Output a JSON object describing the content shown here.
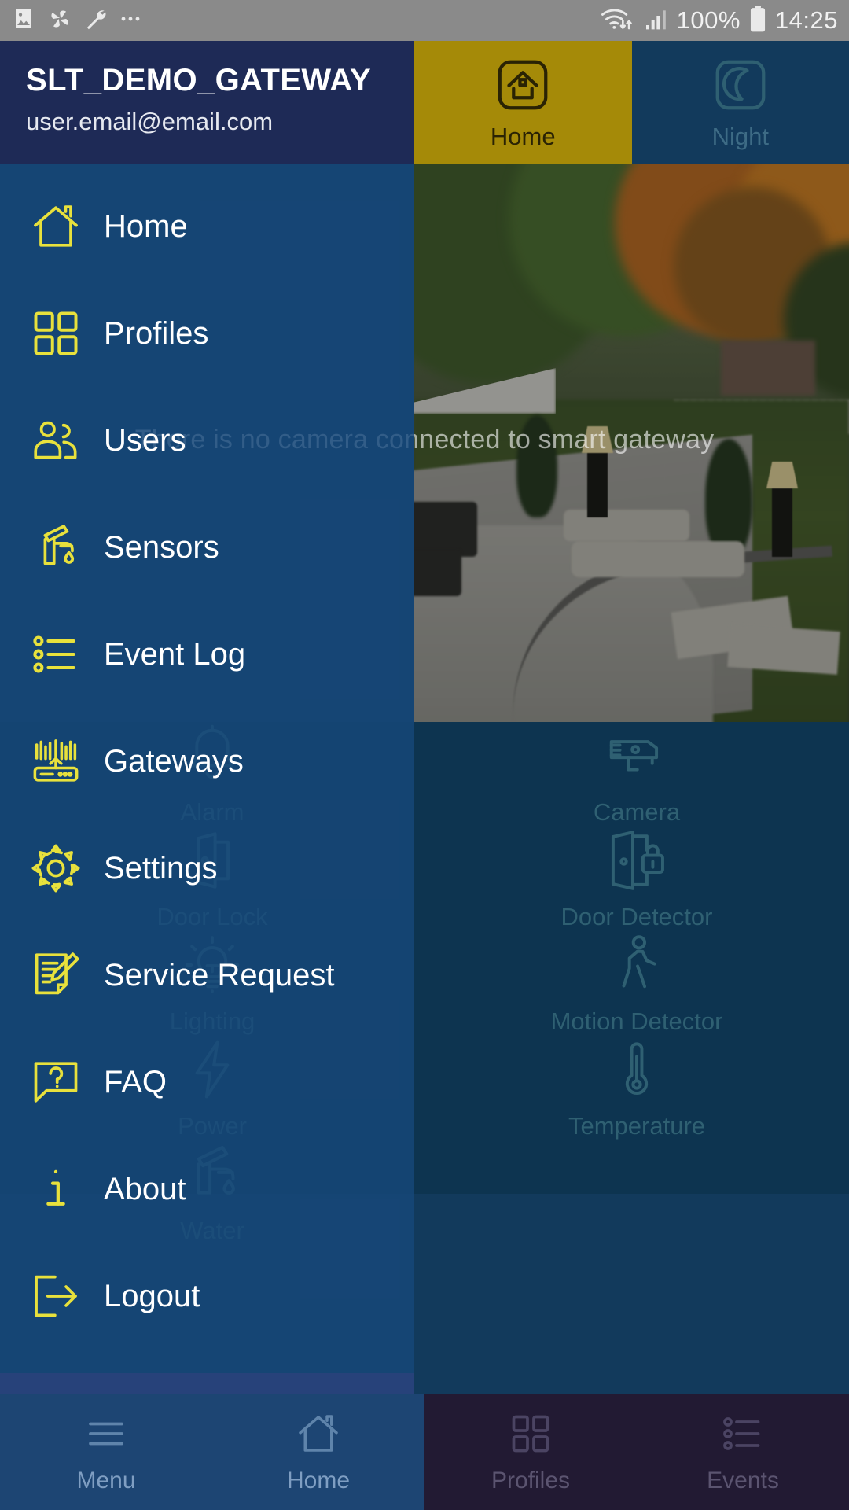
{
  "status_bar": {
    "left_icons": [
      "image-icon",
      "pinwheel-icon",
      "wrench-icon",
      "more-icon"
    ],
    "right_icons": [
      "wifi-icon",
      "signal-icon",
      "battery-icon"
    ],
    "battery_percent": "100%",
    "time": "14:25"
  },
  "drawer": {
    "title": "SLT_DEMO_GATEWAY",
    "email": "user.email@email.com",
    "items": [
      {
        "label": "Home",
        "icon": "home-icon"
      },
      {
        "label": "Profiles",
        "icon": "grid-icon"
      },
      {
        "label": "Users",
        "icon": "users-icon"
      },
      {
        "label": "Sensors",
        "icon": "faucet-icon"
      },
      {
        "label": "Event Log",
        "icon": "list-icon"
      },
      {
        "label": "Gateways",
        "icon": "router-icon"
      },
      {
        "label": "Settings",
        "icon": "gear-icon"
      },
      {
        "label": "Service Request",
        "icon": "note-pencil-icon"
      },
      {
        "label": "FAQ",
        "icon": "question-bubble-icon"
      },
      {
        "label": "About",
        "icon": "info-icon"
      },
      {
        "label": "Logout",
        "icon": "logout-icon"
      }
    ]
  },
  "mode_tabs": [
    {
      "label": "Home",
      "icon": "home-rounded-icon",
      "active": true
    },
    {
      "label": "Night",
      "icon": "moon-icon",
      "active": false
    }
  ],
  "camera": {
    "message": "There is no camera connected to smart gateway"
  },
  "devices": [
    {
      "label": "Alarm",
      "icon": "bell-icon"
    },
    {
      "label": "Camera",
      "icon": "cctv-icon"
    },
    {
      "label": "Door Detector",
      "icon": "door-lock-icon"
    },
    {
      "label": "Door Lock",
      "icon": "padlock-icon"
    },
    {
      "label": "Lighting",
      "icon": "bulb-icon"
    },
    {
      "label": "Motion Detector",
      "icon": "walking-person-icon"
    },
    {
      "label": "Power",
      "icon": "bolt-icon"
    },
    {
      "label": "Temperature",
      "icon": "thermometer-icon"
    },
    {
      "label": "Water",
      "icon": "faucet-icon"
    }
  ],
  "bottom_nav": [
    {
      "label": "Menu",
      "icon": "hamburger-icon"
    },
    {
      "label": "Home",
      "icon": "home-outline-icon"
    },
    {
      "label": "Profiles",
      "icon": "grid-icon"
    },
    {
      "label": "Events",
      "icon": "list-icon"
    }
  ],
  "colors": {
    "accent_yellow": "#e8e13c",
    "tab_active": "#a58a08",
    "header_navy": "#1e2a56",
    "panel_blue": "#0d3450",
    "drawer_blue": "#17487b",
    "device_icon": "#2f6072"
  }
}
